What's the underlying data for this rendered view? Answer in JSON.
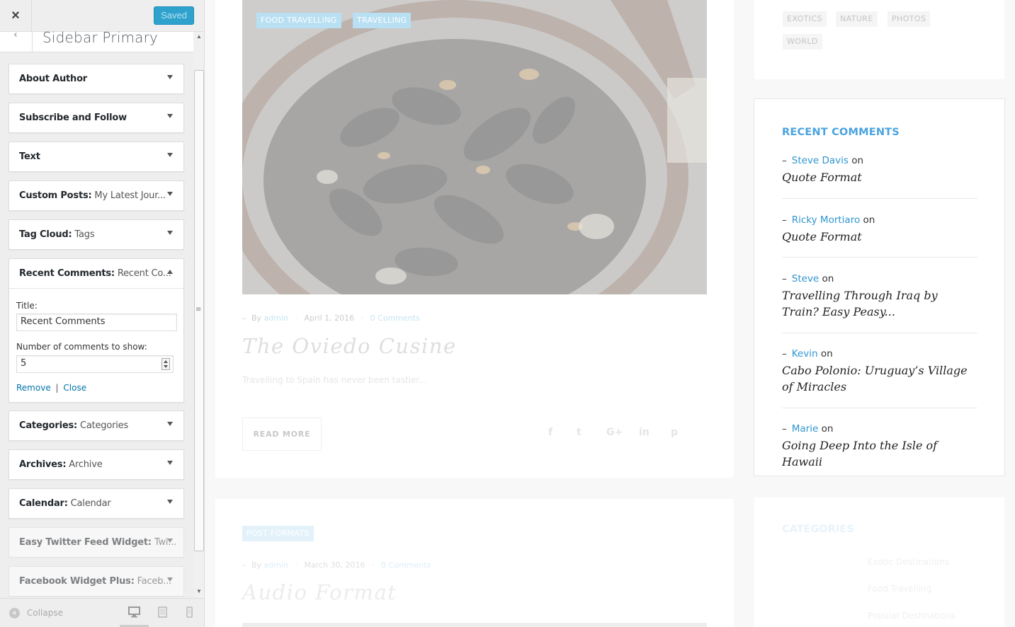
{
  "customizer": {
    "close_label": "×",
    "saved_label": "Saved",
    "section_title": "Sidebar Primary",
    "widgets_before": [
      {
        "name": "About Author",
        "sub": ""
      },
      {
        "name": "Subscribe and Follow",
        "sub": ""
      },
      {
        "name": "Text",
        "sub": ""
      },
      {
        "name": "Custom Posts:",
        "sub": " My Latest Jour..."
      },
      {
        "name": "Tag Cloud:",
        "sub": " Tags"
      }
    ],
    "recent_widget": {
      "name": "Recent Comments:",
      "sub": " Recent Co...",
      "title_label": "Title:",
      "title_value": "Recent Comments",
      "number_label": "Number of comments to show:",
      "number_value": "5",
      "remove_label": "Remove",
      "divider": "|",
      "close_label": "Close"
    },
    "widgets_after": [
      {
        "name": "Categories:",
        "sub": " Categories"
      },
      {
        "name": "Archives:",
        "sub": " Archive"
      },
      {
        "name": "Calendar:",
        "sub": " Calendar"
      },
      {
        "name": "Easy Twitter Feed Widget:",
        "sub": " Twi..."
      },
      {
        "name": "Facebook Widget Plus:",
        "sub": " Faceb..."
      }
    ],
    "collapse_label": "Collapse",
    "accent_color": "#2ea2cc"
  },
  "preview": {
    "post1": {
      "tags": [
        "FOOD TRAVELLING",
        "TRAVELLING"
      ],
      "meta_by": "By",
      "meta_author": "admin",
      "meta_date": "April 1, 2016",
      "meta_comments": "0 Comments",
      "title": "The Oviedo Cusine",
      "excerpt": "Travelling to Spain has never been tastier...",
      "read_more": "READ MORE",
      "share_icons": [
        "f",
        "t",
        "G+",
        "in",
        "p"
      ]
    },
    "post2": {
      "tag": "POST FORMATS",
      "meta_by": "By",
      "meta_author": "admin",
      "meta_date": "March 30, 2016",
      "meta_comments": "0 Comments",
      "title": "Audio Format"
    },
    "tag_cloud": [
      "EXOTICS",
      "NATURE",
      "PHOTOS",
      "WORLD"
    ],
    "recent_comments": {
      "heading": "RECENT COMMENTS",
      "on_word": "on",
      "items": [
        {
          "author": "Steve Davis",
          "post": "Quote Format"
        },
        {
          "author": "Ricky Mortiaro",
          "post": "Quote Format"
        },
        {
          "author": "Steve",
          "post": "Travelling Through Iraq by Train? Easy Peasy..."
        },
        {
          "author": "Kevin",
          "post": "Cabo Polonio: Uruguay’s Village of Miracles"
        },
        {
          "author": "Marie",
          "post": "Going Deep Into the Isle of Hawaii"
        }
      ],
      "accent_color": "#4aa3df"
    },
    "categories": {
      "heading": "CATEGORIES",
      "items": [
        "Exotic Destinations",
        "Food Travelling",
        "Popular Destinations"
      ]
    }
  }
}
